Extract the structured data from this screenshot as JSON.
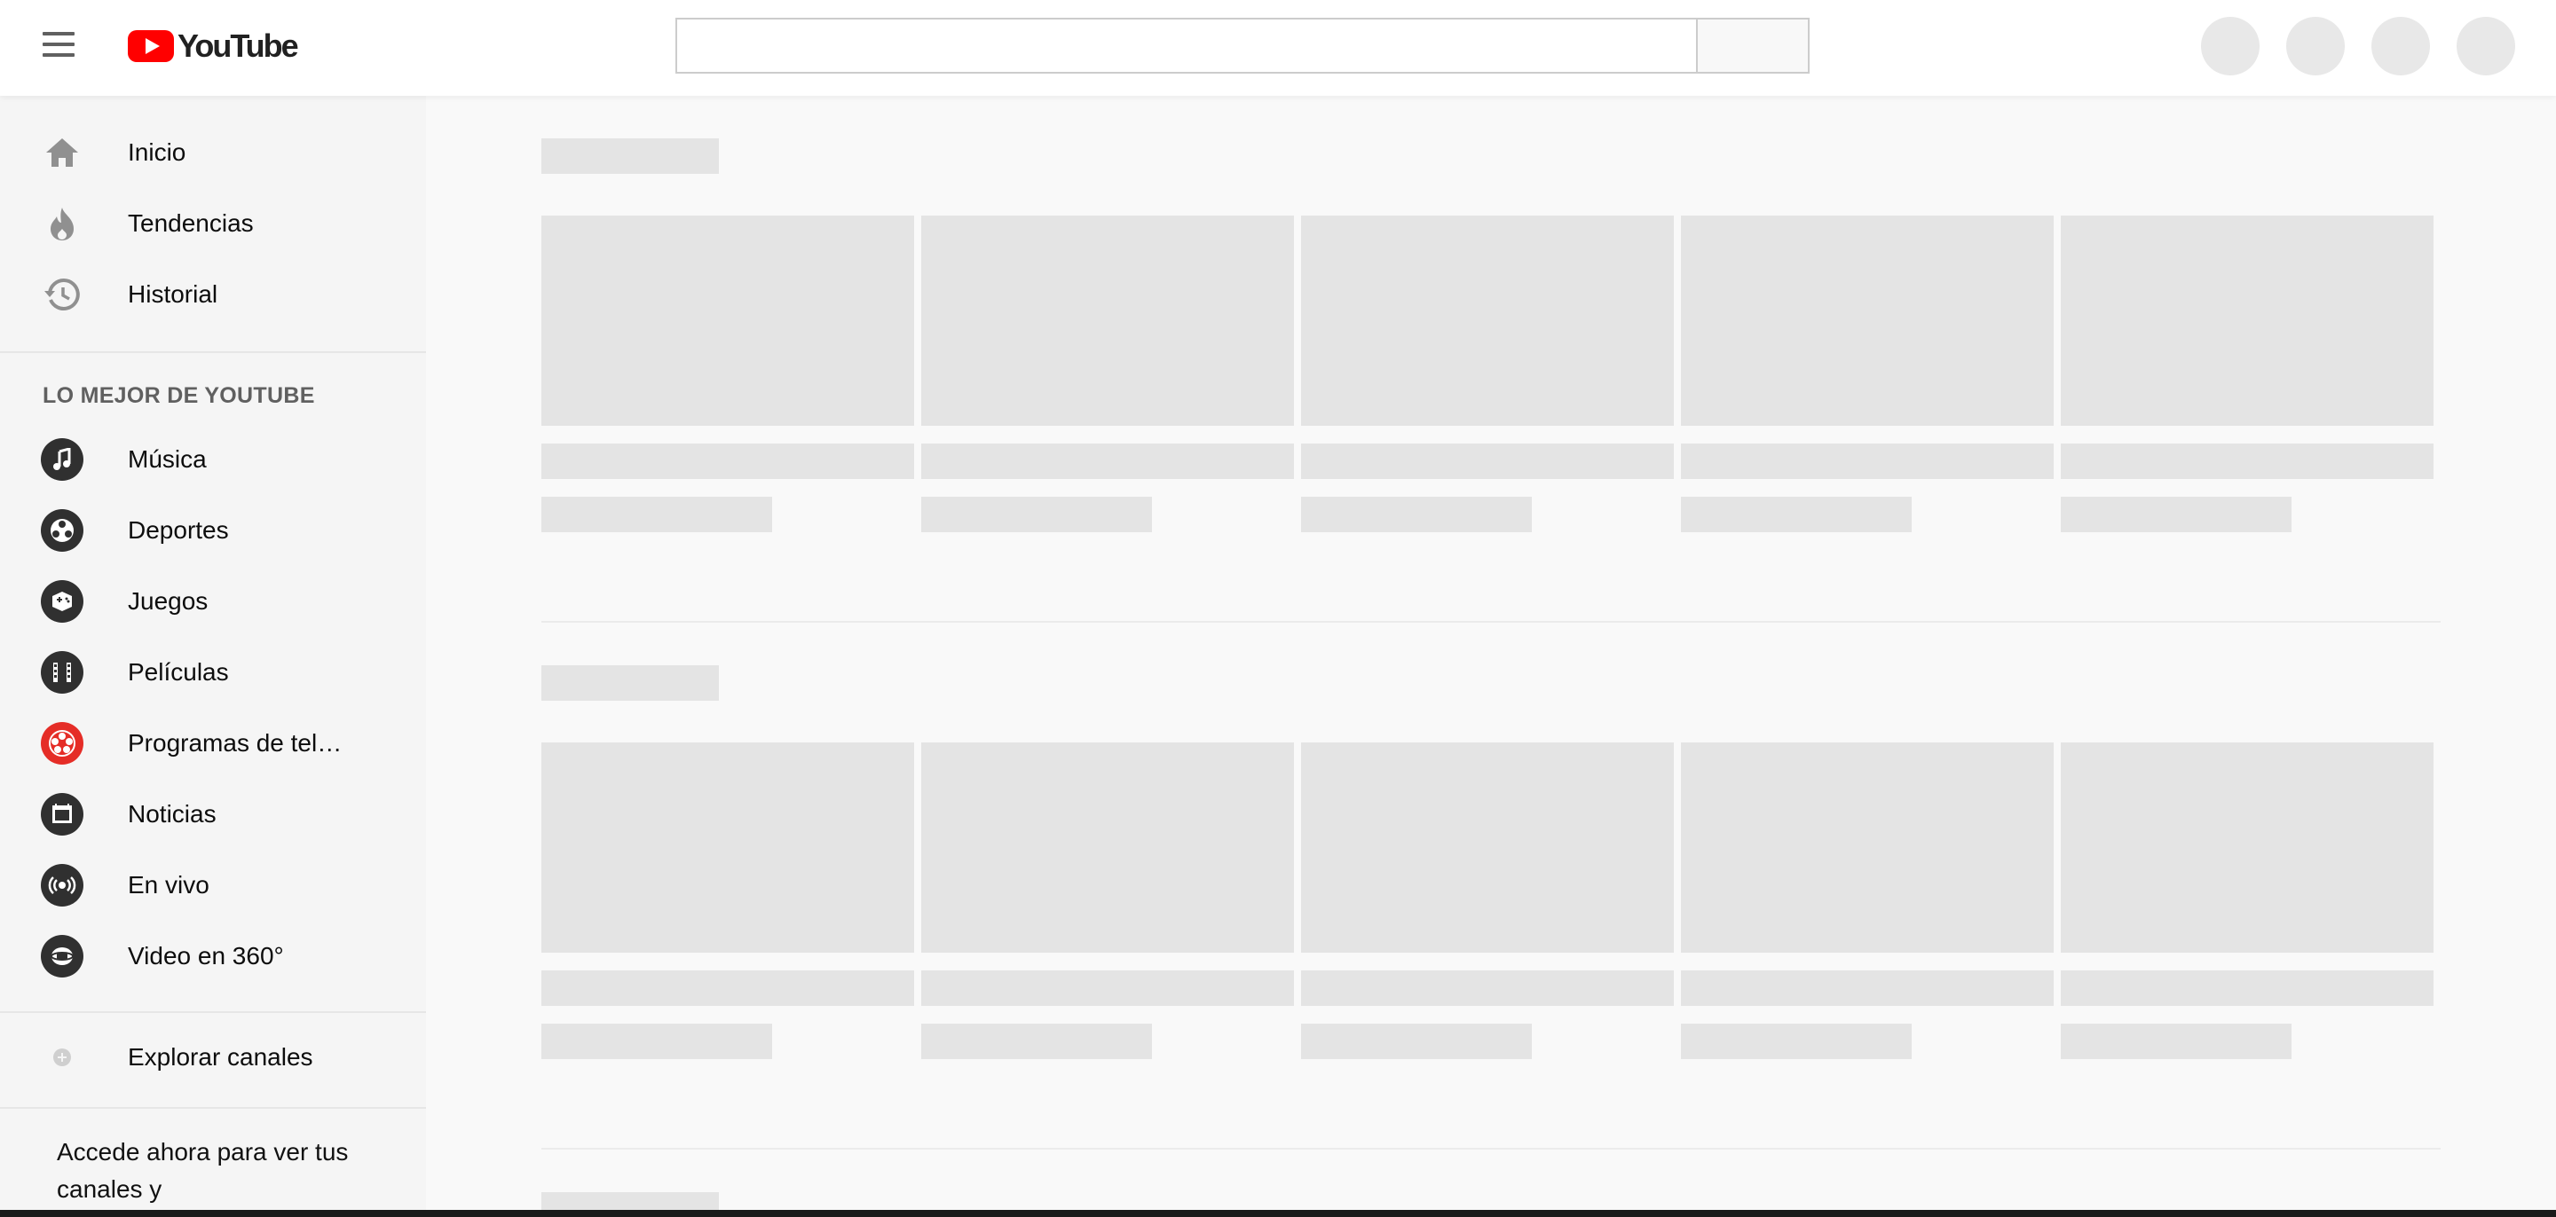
{
  "header": {
    "logo_text": "YouTube"
  },
  "sidebar": {
    "main_items": [
      {
        "label": "Inicio",
        "icon": "home-icon"
      },
      {
        "label": "Tendencias",
        "icon": "flame-icon"
      },
      {
        "label": "Historial",
        "icon": "history-icon"
      }
    ],
    "section_title": "LO MEJOR DE YOUTUBE",
    "best_items": [
      {
        "label": "Música",
        "icon": "music-icon"
      },
      {
        "label": "Deportes",
        "icon": "sports-icon"
      },
      {
        "label": "Juegos",
        "icon": "gaming-icon"
      },
      {
        "label": "Películas",
        "icon": "film-icon"
      },
      {
        "label": "Programas de tel…",
        "icon": "tv-shows-icon"
      },
      {
        "label": "Noticias",
        "icon": "news-icon"
      },
      {
        "label": "En vivo",
        "icon": "live-icon"
      },
      {
        "label": "Video en 360°",
        "icon": "video-360-icon"
      }
    ],
    "explore_label": "Explorar canales",
    "signin_prompt": "Accede ahora para ver tus canales y"
  },
  "colors": {
    "brand_red": "#ff0000",
    "tv_icon_red": "#e52d27",
    "skeleton": "#e4e4e4",
    "sidebar_bg": "#f5f5f5"
  }
}
